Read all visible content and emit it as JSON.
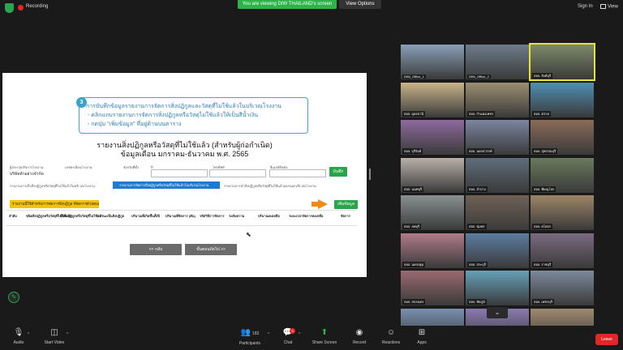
{
  "topbar": {
    "recording_label": "Recording",
    "viewing_banner": "You are viewing DIW THAILAND's screen",
    "view_options": "View Options",
    "sign_in": "Sign In",
    "view_label": "View"
  },
  "shared_doc": {
    "callout_number": "3",
    "callout_lines": [
      "การบันทึกข้อมูลรายงานการจัดการสิ่งปฏิกูลและวัสดุที่ไม่ใช้แล้วในบริเวณโรงงาน",
      "- คลิกแถบรายงานการจัดการสิ่งปฏิกูลหรือวัสดุไม่ใช้แล้วให้เป็นสีน้ำเงิน",
      "- กดปุ่ม \"เพิ่มข้อมูล\" ที่อยู่ด้านบนตาราง"
    ],
    "title_line1": "รายงานสิ่งปฏิกูลหรือวัสดุที่ไม่ใช้แล้ว (สำหรับผู้ก่อกำเนิด)",
    "title_line2": "ข้อมูลเดือน มกราคม-ธันวาคม พ.ศ. 2565",
    "fields": {
      "factory_label": "ผู้ประกอบกิจการโรงงาน",
      "factory_value": "บริษัทตัวอย่างจำกัด",
      "register_label": "เลขทะเบียนโรงงาน",
      "register_value": "",
      "province_label": "จังหวัดที่ตั้ง",
      "year_label": "ปี",
      "year_value": "",
      "phone_label": "โทรศัพท์",
      "email_label": "อีเมลล์ติดต่อ"
    },
    "save_button": "บันทึก",
    "file_note_1": "รายงานการเก็บสิ่งปฏิกูลหรือวัสดุที่ไม่ใช้แล้วในบริเวณโรงงาน",
    "active_tab": "รายงานการจัดการสิ่งปฏิกูลหรือวัสดุที่ไม่ใช้แล้วในบริเวณโรงงาน",
    "file_note_2": "รายงานการนำสิ่งปฏิกูลหรือวัสดุที่ไม่ใช้แล้วออกนอกบริเวณโรงงาน",
    "alert_text": "รายงานนี้ใช้สำหรับการจัดการสิ่งปฏิกูล ที่จัดการด้วยตนเองภายในโรงงาน",
    "add_button": "เพิ่มข้อมูล",
    "table_headers": [
      "ลำดับ",
      "ชนิดสิ่งปฏิกูลหรือวัสดุที่ไม่ใช้แล้ว",
      "ชื่อสิ่งปฏิกูลหรือวัสดุที่ไม่ใช้แล้ว",
      "สถานะเป็นสิ่งปฏิกูล",
      "ปริมาณที่เกิดขึ้นทั้งปี",
      "ปริมาณที่จัดการ (ตัน)",
      "รหัสวิธีการจัดการ",
      "ระดับความ",
      "ปริมาณคงเหลือ",
      "ระยะเวลาจัดการคงเหลือ",
      "จัดการ"
    ],
    "back_button": "<< กลับ",
    "next_button": "ขั้นตอนถัดไป >>"
  },
  "gallery": {
    "tiles": [
      {
        "name": "DIW_Office_1",
        "bg": "#8aa0b8"
      },
      {
        "name": "DIW_Office_2",
        "bg": "#6e7c8a"
      },
      {
        "name": "สอจ. สิงห์บุรี",
        "bg": "#7d8a6a"
      },
      {
        "name": "สอจ. อุดรธานี",
        "bg": "#c9b48a"
      },
      {
        "name": "สอจ. กำแพงเพชร",
        "bg": "#9a8f70"
      },
      {
        "name": "สอจ. ตราด",
        "bg": "#4f8fb3"
      },
      {
        "name": "สอจ. บุรีรัมย์",
        "bg": "#8f6a9e"
      },
      {
        "name": "สอจ. นครสวรรค์",
        "bg": "#7b86a0"
      },
      {
        "name": "สอจ. สุพรรณบุรี",
        "bg": "#8b6b58"
      },
      {
        "name": "สอจ. นนทบุรี",
        "bg": "#b8b0a8"
      },
      {
        "name": "สอจ. ลำปาง",
        "bg": "#5f6e7a"
      },
      {
        "name": "สอจ. พิษณุโลก",
        "bg": "#6a7a5c"
      },
      {
        "name": "สอจ. ลพบุรี",
        "bg": "#8a9090"
      },
      {
        "name": "สอจ. ชุมพร",
        "bg": "#6f6256"
      },
      {
        "name": "สอจ. ยโสธร",
        "bg": "#9c8566"
      },
      {
        "name": "สอจ. นครปฐม",
        "bg": "#b07b8a"
      },
      {
        "name": "สอจ. สระบุรี",
        "bg": "#5c7ca0"
      },
      {
        "name": "สอจ. ราชบุรี",
        "bg": "#7a6b80"
      },
      {
        "name": "สอจ. สกลนคร",
        "bg": "#9a6a70"
      },
      {
        "name": "สอจ. ชัยภูมิ",
        "bg": "#66a0b8"
      },
      {
        "name": "สอจ. เพชรบุรี",
        "bg": "#7c8a9c"
      },
      {
        "name": "สอจ. มุกดาหาร",
        "bg": "#7890b0"
      },
      {
        "name": "สอจ. ปทุมธานี",
        "bg": "#8a7ab0"
      },
      {
        "name": "สอจ. ร้อยเอ็ด",
        "bg": "#a08a70"
      }
    ]
  },
  "toolbar": {
    "audio": "Audio",
    "video": "Start Video",
    "participants": "Participants",
    "participants_count": "182",
    "chat": "Chat",
    "chat_badge": "9",
    "share": "Share Screen",
    "record": "Record",
    "reactions": "Reactions",
    "apps": "Apps",
    "leave": "Leave"
  }
}
